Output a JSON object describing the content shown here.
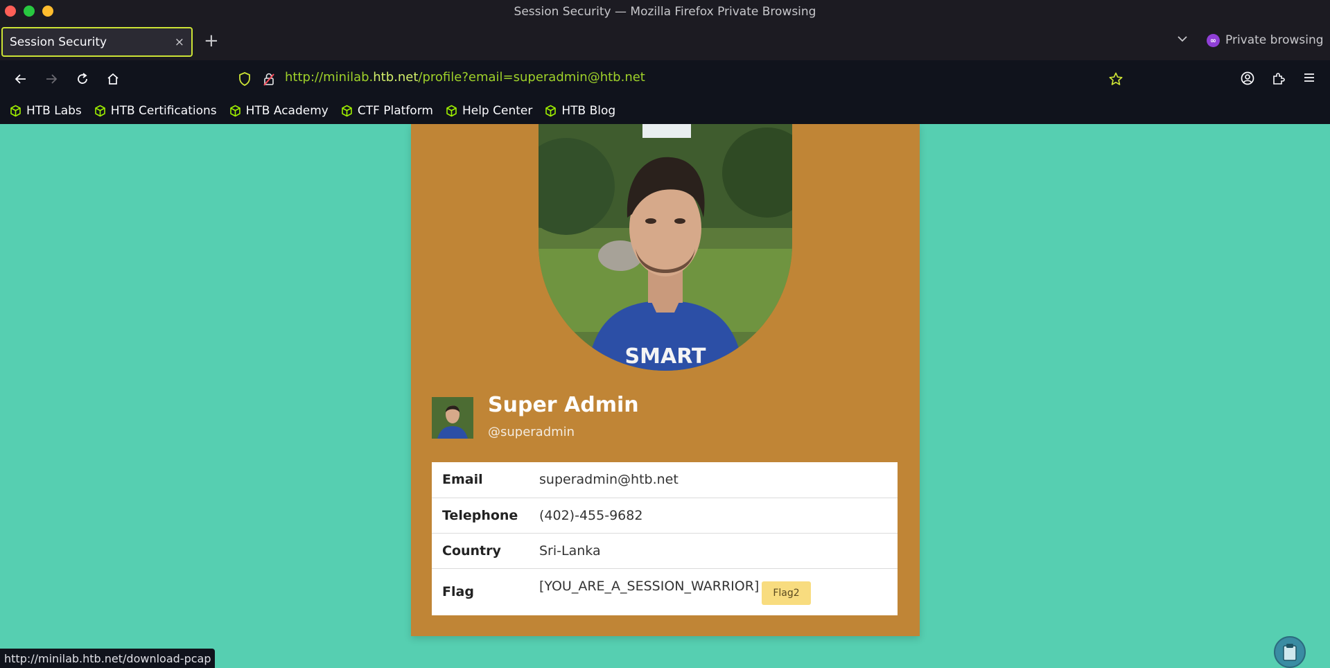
{
  "window": {
    "title": "Session Security — Mozilla Firefox Private Browsing"
  },
  "tabs": {
    "active_label": "Session Security",
    "close_glyph": "×",
    "new_tab_glyph": "+",
    "private_label": "Private browsing"
  },
  "navbar": {
    "url_prefix": "http://minilab.",
    "url_host": "htb.net",
    "url_path": "/profile?email=superadmin@htb.net"
  },
  "bookmarks": [
    {
      "label": "HTB Labs",
      "icon": "cube-icon"
    },
    {
      "label": "HTB Certifications",
      "icon": "cube-icon"
    },
    {
      "label": "HTB Academy",
      "icon": "cube-icon"
    },
    {
      "label": "CTF Platform",
      "icon": "cube-icon"
    },
    {
      "label": "Help Center",
      "icon": "cube-icon"
    },
    {
      "label": "HTB Blog",
      "icon": "cube-icon"
    }
  ],
  "profile": {
    "name": "Super Admin",
    "handle": "@superadmin",
    "shirt_text": "SMART",
    "fields": [
      {
        "key": "Email",
        "value": "superadmin@htb.net"
      },
      {
        "key": "Telephone",
        "value": "(402)-455-9682"
      },
      {
        "key": "Country",
        "value": "Sri-Lanka"
      },
      {
        "key": "Flag",
        "value": "[YOU_ARE_A_SESSION_WARRIOR]",
        "tag": "Flag2"
      }
    ]
  },
  "statusbar": {
    "link": "http://minilab.htb.net/download-pcap"
  },
  "colors": {
    "page_bg": "#56cfb1",
    "card_bg": "#c08536",
    "chrome_dark": "#10131c",
    "url_green": "#9fd22a",
    "tab_border": "#cde435",
    "flag_tag": "#f8dc7f"
  }
}
